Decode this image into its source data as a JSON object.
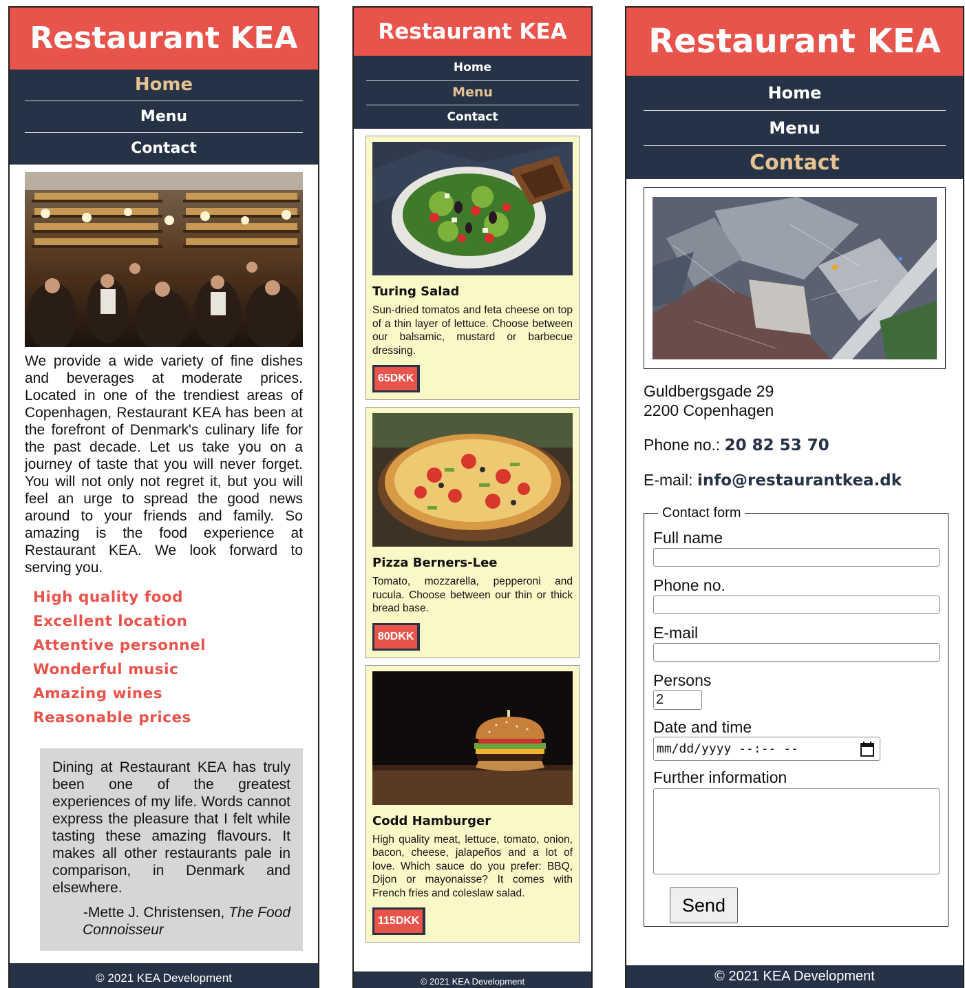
{
  "brand": "Restaurant KEA",
  "nav": [
    "Home",
    "Menu",
    "Contact"
  ],
  "footer": "© 2021 KEA Development",
  "home": {
    "intro": "We provide a wide variety of fine dishes and beverages at moderate prices. Located in one of the trendiest areas of Copenhagen, Restaurant KEA has been at the forefront of Denmark's culinary life for the past decade. Let us take you on a journey of taste that you will never forget. You will not only not regret it, but you will feel an urge to spread the good news around to your friends and family. So amazing is the food experience at Restaurant KEA. We look forward to serving you.",
    "features": [
      "High quality food",
      "Excellent location",
      "Attentive personnel",
      "Wonderful music",
      "Amazing wines",
      "Reasonable prices"
    ],
    "quote": {
      "text": "Dining at Restaurant KEA has truly been one of the greatest experiences of my life. Words cannot express the pleasure that I felt while tasting these amazing flavours. It makes all other restaurants pale in comparison, in Denmark and elsewhere.",
      "author": "-Mette J. Christensen,",
      "source": "The Food Connoisseur"
    }
  },
  "menu": {
    "items": [
      {
        "name": "Turing Salad",
        "desc": "Sun-dried tomatos and feta cheese on top of a thin layer of lettuce. Choose between our balsamic, mustard or barbecue dressing.",
        "price": "65DKK"
      },
      {
        "name": "Pizza Berners-Lee",
        "desc": "Tomato, mozzarella, pepperoni and rucula. Choose between our thin or thick bread base.",
        "price": "80DKK"
      },
      {
        "name": "Codd Hamburger",
        "desc": "High quality meat, lettuce, tomato, onion, bacon, cheese, jalapeños and a lot of love. Which sauce do you prefer: BBQ, Dijon or mayonaisse? It comes with French fries and coleslaw salad.",
        "price": "115DKK"
      }
    ]
  },
  "contact": {
    "address_line1": "Guldbergsgade 29",
    "address_line2": "2200 Copenhagen",
    "phone_label": "Phone no.: ",
    "phone": "20 82 53 70",
    "email_label": "E-mail: ",
    "email": "info@restaurantkea.dk",
    "form": {
      "legend": "Contact form",
      "full_name_label": "Full name",
      "phone_label": "Phone no.",
      "email_label": "E-mail",
      "persons_label": "Persons",
      "persons_value": "2",
      "datetime_label": "Date and time",
      "datetime_placeholder": "mm/dd/yyyy --:-- --",
      "further_label": "Further information",
      "send_label": "Send"
    }
  },
  "colors": {
    "accent": "#e8534b",
    "nav_bg": "#263246",
    "active_nav": "#e6c291",
    "card_bg": "#fbf8c8",
    "quote_bg": "#d6d6d6"
  },
  "icons": {
    "date_picker": "calendar-icon"
  }
}
